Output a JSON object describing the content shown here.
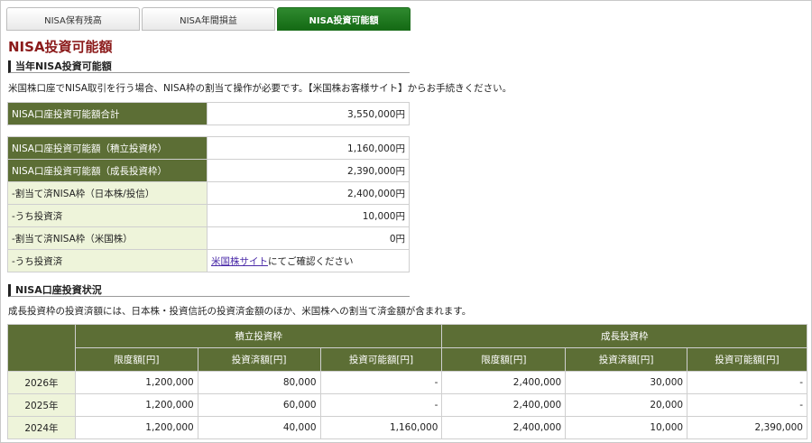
{
  "tabs": [
    {
      "label": "NISA保有残高",
      "active": false
    },
    {
      "label": "NISA年間損益",
      "active": false
    },
    {
      "label": "NISA投資可能額",
      "active": true
    }
  ],
  "page_title": "NISA投資可能額",
  "section1": {
    "title": "当年NISA投資可能額",
    "description": "米国株口座でNISA取引を行う場合、NISA枠の割当て操作が必要です。【米国株お客様サイト】からお手続きください。",
    "total": {
      "label": "NISA口座投資可能額合計",
      "value": "3,550,000円"
    },
    "rows": [
      {
        "label": "NISA口座投資可能額（積立投資枠）",
        "value": "1,160,000円",
        "style": "dark"
      },
      {
        "label": "NISA口座投資可能額（成長投資枠）",
        "value": "2,390,000円",
        "style": "dark"
      },
      {
        "label": "-割当て済NISA枠（日本株/投信）",
        "value": "2,400,000円",
        "style": "light"
      },
      {
        "label": " -うち投資済",
        "value": "10,000円",
        "style": "light"
      },
      {
        "label": "-割当て済NISA枠（米国株）",
        "value": "0円",
        "style": "light"
      }
    ],
    "us_row": {
      "label": " -うち投資済",
      "link_text": "米国株サイト",
      "suffix": "にてご確認ください"
    }
  },
  "section2": {
    "title": "NISA口座投資状況",
    "description": "成長投資枠の投資済額には、日本株・投資信託の投資済金額のほか、米国株への割当て済金額が含まれます。",
    "group_headers": [
      "積立投資枠",
      "成長投資枠"
    ],
    "sub_headers": [
      "限度額[円]",
      "投資済額[円]",
      "投資可能額[円]",
      "限度額[円]",
      "投資済額[円]",
      "投資可能額[円]"
    ],
    "rows": [
      {
        "year": "2026年",
        "cells": [
          "1,200,000",
          "80,000",
          "-",
          "2,400,000",
          "30,000",
          "-"
        ]
      },
      {
        "year": "2025年",
        "cells": [
          "1,200,000",
          "60,000",
          "-",
          "2,400,000",
          "20,000",
          "-"
        ]
      },
      {
        "year": "2024年",
        "cells": [
          "1,200,000",
          "40,000",
          "1,160,000",
          "2,400,000",
          "10,000",
          "2,390,000"
        ]
      }
    ]
  }
}
